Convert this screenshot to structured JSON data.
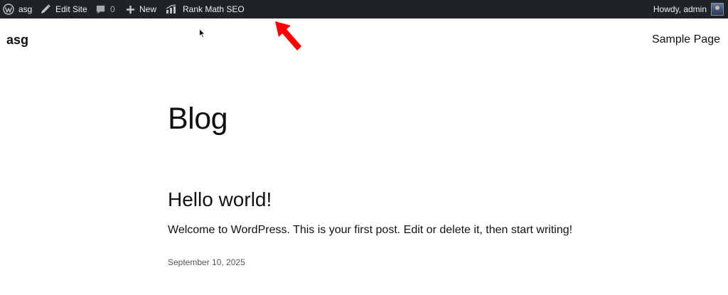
{
  "admin_bar": {
    "site_name": "asg",
    "edit_site": "Edit Site",
    "comments_count": "0",
    "new_label": "New",
    "rank_math_label": "Rank Math SEO",
    "howdy": "Howdy, admin"
  },
  "site": {
    "title": "asg",
    "nav": [
      "Sample Page"
    ]
  },
  "page": {
    "heading": "Blog"
  },
  "post": {
    "title": "Hello world!",
    "excerpt": "Welcome to WordPress. This is your first post. Edit or delete it, then start writing!",
    "date": "September 10, 2025"
  },
  "colors": {
    "admin_bar_bg": "#1d2327",
    "admin_bar_text": "#f0f0f1",
    "annotation_arrow": "#ff0000"
  },
  "icons": [
    "wordpress-icon",
    "edit-site-icon",
    "comment-icon",
    "plus-icon",
    "rank-math-icon",
    "avatar",
    "mouse-cursor-icon",
    "red-arrow-annotation-icon"
  ]
}
